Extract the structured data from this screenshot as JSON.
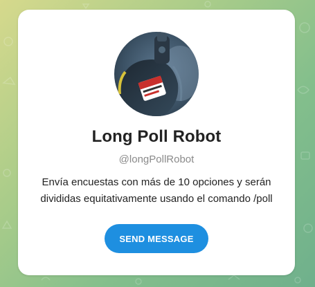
{
  "bot": {
    "name": "Long Poll Robot",
    "username": "@longPollRobot",
    "description": "Envía encuestas con más de 10 opciones y serán divididas equitativamente usando el comando /poll"
  },
  "actions": {
    "send_message_label": "SEND MESSAGE"
  },
  "colors": {
    "accent": "#1e8fe0",
    "card_background": "#ffffff",
    "wallpaper_start": "#d6d98c",
    "wallpaper_end": "#6fb08c"
  },
  "icons": {
    "avatar": "bot-avatar-photo"
  }
}
